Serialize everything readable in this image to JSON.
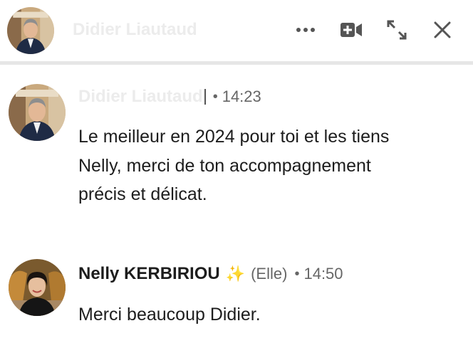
{
  "header": {
    "contact_name": "Didier Liautaud",
    "buttons": {
      "more": "more-options-icon",
      "video": "video-call-icon",
      "expand": "expand-icon",
      "close": "close-icon"
    }
  },
  "messages": [
    {
      "sender": "Didier Liautaud",
      "time": "14:23",
      "separator": "•",
      "text": "Le meilleur en 2024 pour toi et les tiens Nelly, merci de ton accompagnement précis et délicat."
    },
    {
      "sender": "Nelly KERBIRIOU",
      "emoji": "✨",
      "pronoun": "(Elle)",
      "time": "14:50",
      "separator": "•",
      "text": "Merci beaucoup Didier."
    }
  ],
  "colors": {
    "accent_sparkle": "#f2c230",
    "muted_text": "#666666",
    "blurred_name": "#ececec",
    "divider": "#e6e6e6"
  }
}
